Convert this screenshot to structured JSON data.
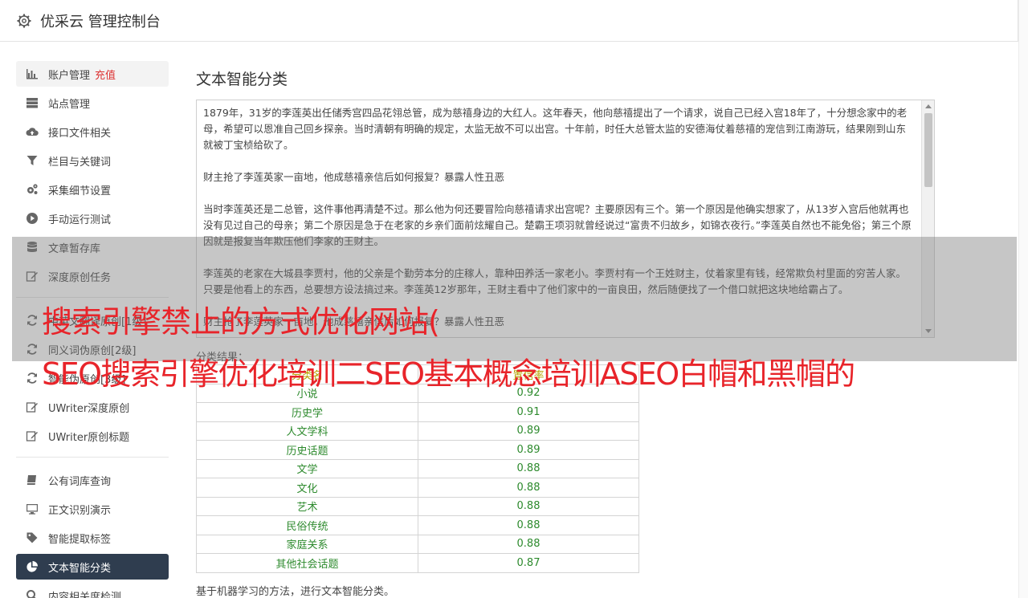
{
  "app": {
    "title": "优采云 管理控制台"
  },
  "sidebar": {
    "group1": [
      {
        "label": "账户管理",
        "extra": "充值",
        "icon": "bar-chart-icon"
      },
      {
        "label": "站点管理",
        "icon": "server-icon"
      },
      {
        "label": "接口文件相关",
        "icon": "cloud-upload-icon"
      },
      {
        "label": "栏目与关键词",
        "icon": "filter-icon"
      },
      {
        "label": "采集细节设置",
        "icon": "cogs-icon"
      },
      {
        "label": "手动运行测试",
        "icon": "play-circle-icon"
      },
      {
        "label": "文章暂存库",
        "icon": "database-icon"
      },
      {
        "label": "深度原创任务",
        "icon": "edit-icon"
      }
    ],
    "group2": [
      {
        "label": "中英文翻译原创[1级]",
        "icon": "refresh-icon"
      },
      {
        "label": "同义词伪原创[2级]",
        "icon": "refresh-icon"
      },
      {
        "label": "智能伪原创[3级]",
        "icon": "refresh-icon"
      },
      {
        "label": "UWriter深度原创",
        "icon": "edit-icon"
      },
      {
        "label": "UWriter原创标题",
        "icon": "edit-icon"
      }
    ],
    "group3": [
      {
        "label": "公有词库查询",
        "icon": "book-icon"
      },
      {
        "label": "正文识别演示",
        "icon": "monitor-icon"
      },
      {
        "label": "智能提取标签",
        "icon": "tag-icon"
      },
      {
        "label": "文本智能分类",
        "icon": "pie-chart-icon",
        "active": true
      },
      {
        "label": "内容相关度检测",
        "icon": "search-icon"
      }
    ]
  },
  "main": {
    "title": "文本智能分类",
    "text_paragraphs": [
      "1879年，31岁的李莲英出任储秀宫四品花翎总管，成为慈禧身边的大红人。这年春天，他向慈禧提出了一个请求，说自己已经入宫18年了，十分想念家中的老母，希望可以恩准自己回乡探亲。当时清朝有明确的规定，太监无故不可以出宫。十年前，时任大总管太监的安德海仗着慈禧的宠信到江南游玩，结果刚到山东就被丁宝桢给砍了。",
      "财主抢了李莲英家一亩地，他成慈禧亲信后如何报复？暴露人性丑恶",
      "当时李莲英还是二总管，这件事他再清楚不过。那么他为何还要冒险向慈禧请求出宫呢？主要原因有三个。第一个原因是他确实想家了，从13岁入宫后他就再也没有见过自己的母亲；第二个原因是急于在老家的乡亲们面前炫耀自己。楚霸王项羽就曾经说过“富贵不归故乡，如锦衣夜行。”李莲英自然也不能免俗；第三个原因就是报复当年欺压他们李家的王财主。",
      "李莲英的老家在大城县李贾村，他的父亲是个勤劳本分的庄稼人，靠种田养活一家老小。李贾村有一个王姓财主，仗着家里有钱，经常欺负村里面的穷苦人家。只要是他看上的东西，总要想方设法搞过来。李莲英12岁那年，王财主看中了他们家中的一亩良田，然后随便找了一个借口就把这块地给霸占了。",
      "财主抢了李莲英家一亩地，他成慈禧亲信后如何报复？暴露人性丑恶"
    ],
    "result_label": "分类结果：",
    "table": {
      "headers": [
        "分类名",
        "置信率"
      ],
      "rows": [
        [
          "小说",
          "0.92"
        ],
        [
          "历史学",
          "0.91"
        ],
        [
          "人文学科",
          "0.89"
        ],
        [
          "历史话题",
          "0.89"
        ],
        [
          "文学",
          "0.88"
        ],
        [
          "文化",
          "0.88"
        ],
        [
          "艺术",
          "0.88"
        ],
        [
          "民俗传统",
          "0.88"
        ],
        [
          "家庭关系",
          "0.88"
        ],
        [
          "其他社会话题",
          "0.87"
        ]
      ]
    },
    "footer_note": "基于机器学习的方法，进行文本智能分类。"
  },
  "overlay": {
    "line1": "搜索引擎禁止的方式优化网站(",
    "line2": "SEO搜索引擎优化培训二SEO基本概念培训ASEO白帽和黑帽的"
  },
  "colors": {
    "active_nav": "#2f3d4f",
    "recharge": "#dd3333",
    "overlay_text": "#e8242a",
    "result_text": "#2d8a2d"
  }
}
